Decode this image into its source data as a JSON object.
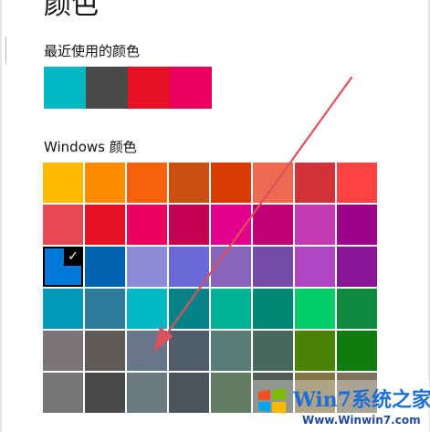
{
  "title": "颜色",
  "recent": {
    "label": "最近使用的颜色",
    "colors": [
      "#00B7C3",
      "#4C4A48",
      "#E81123",
      "#EA005E"
    ]
  },
  "windows": {
    "label": "Windows 颜色",
    "selected_index": 16,
    "colors": [
      "#FFB900",
      "#FF8C00",
      "#F7630C",
      "#CA5010",
      "#DA3B01",
      "#EF6950",
      "#D13438",
      "#FF4343",
      "#E74856",
      "#E81123",
      "#EA005E",
      "#C30052",
      "#E3008C",
      "#BF0077",
      "#C239B3",
      "#9A0089",
      "#0078D7",
      "#0063B1",
      "#8E8CD8",
      "#6B69D6",
      "#8764B8",
      "#744DA9",
      "#B146C2",
      "#881798",
      "#0099BC",
      "#2D7D9A",
      "#00B7C3",
      "#038387",
      "#00B294",
      "#018574",
      "#00CC6A",
      "#10893E",
      "#7A7574",
      "#5D5A58",
      "#68768A",
      "#515C6B",
      "#567C73",
      "#486860",
      "#498205",
      "#107C10",
      "#767676",
      "#4C4A48",
      "#69797E",
      "#4A5459",
      "#647C64",
      "#525E54",
      "#847545",
      "#7E735F"
    ]
  },
  "watermark": {
    "brand": "Win7系统之家",
    "url": "Www.Winwin7.com"
  }
}
